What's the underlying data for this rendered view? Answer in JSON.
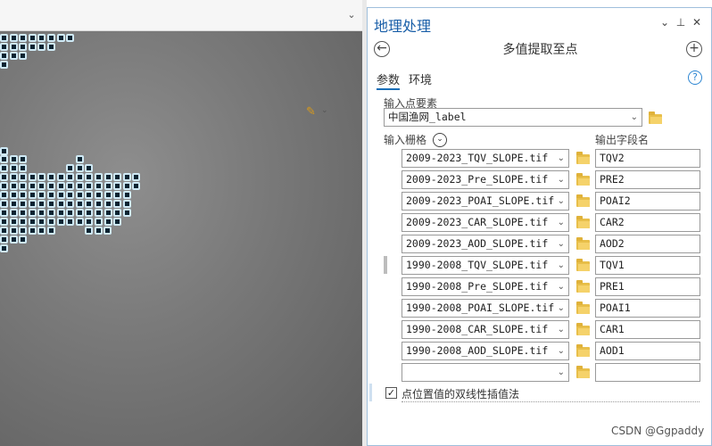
{
  "pane": {
    "title": "地理处理",
    "tool_title": "多值提取至点",
    "tabs": [
      "参数",
      "环境"
    ],
    "controls": {
      "menu": "⌄",
      "pin": "⊥",
      "close": "✕",
      "back": "←",
      "add": "+",
      "help": "?"
    }
  },
  "input_features": {
    "label": "输入点要素",
    "value": "中国渔网_label"
  },
  "rasters": {
    "label": "输入栅格",
    "output_label": "输出字段名",
    "rows": [
      {
        "raster": "2009-2023_TQV_SLOPE.tif",
        "field": "TQV2"
      },
      {
        "raster": "2009-2023_Pre_SLOPE.tif",
        "field": "PRE2"
      },
      {
        "raster": "2009-2023_POAI_SLOPE.tif",
        "field": "POAI2"
      },
      {
        "raster": "2009-2023_CAR_SLOPE.tif",
        "field": "CAR2"
      },
      {
        "raster": "2009-2023_AOD_SLOPE.tif",
        "field": "AOD2"
      },
      {
        "raster": "1990-2008_TQV_SLOPE.tif",
        "field": "TQV1"
      },
      {
        "raster": "1990-2008_Pre_SLOPE.tif",
        "field": "PRE1"
      },
      {
        "raster": "1990-2008_POAI_SLOPE.tif",
        "field": "POAI1"
      },
      {
        "raster": "1990-2008_CAR_SLOPE.tif",
        "field": "CAR1"
      },
      {
        "raster": "1990-2008_AOD_SLOPE.tif",
        "field": "AOD1"
      },
      {
        "raster": "",
        "field": ""
      }
    ]
  },
  "bilinear": {
    "label": "点位置值的双线性插值法",
    "checked": true
  },
  "watermark": "CSDN @Ggpaddy"
}
